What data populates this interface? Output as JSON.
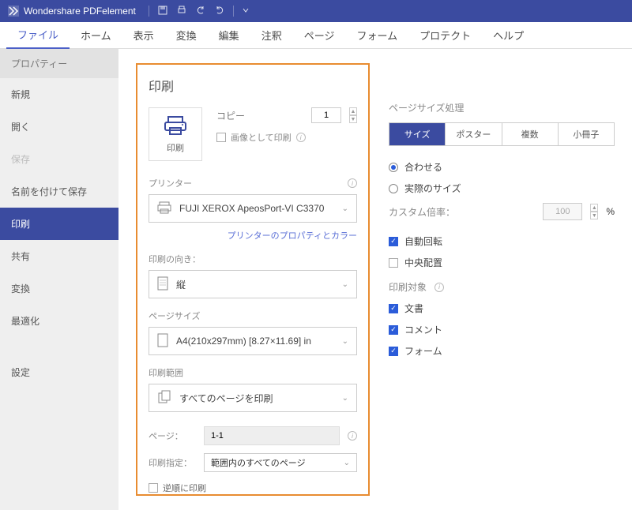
{
  "titlebar": {
    "title": "Wondershare PDFelement"
  },
  "menu": {
    "items": [
      "ファイル",
      "ホーム",
      "表示",
      "変換",
      "編集",
      "注釈",
      "ページ",
      "フォーム",
      "プロテクト",
      "ヘルプ"
    ],
    "active": 0
  },
  "sidebar": {
    "header": "プロパティー",
    "items": [
      {
        "label": "新規",
        "sel": false,
        "muted": false
      },
      {
        "label": "開く",
        "sel": false,
        "muted": false
      },
      {
        "label": "保存",
        "sel": false,
        "muted": true
      },
      {
        "label": "名前を付けて保存",
        "sel": false,
        "muted": false
      },
      {
        "label": "印刷",
        "sel": true,
        "muted": false
      },
      {
        "label": "共有",
        "sel": false,
        "muted": false
      },
      {
        "label": "変換",
        "sel": false,
        "muted": false
      },
      {
        "label": "最適化",
        "sel": false,
        "muted": false
      },
      {
        "label": "設定",
        "sel": false,
        "muted": false
      }
    ]
  },
  "print": {
    "heading": "印刷",
    "card_label": "印刷",
    "copy_label": "コピー",
    "copy_value": "1",
    "as_image_label": "画像として印刷",
    "printer_label": "プリンター",
    "printer_value": "FUJI XEROX ApeosPort-VI C3370",
    "printer_link": "プリンターのプロパティとカラー",
    "orient_label": "印刷の向き：",
    "orient_value": "縦",
    "size_label": "ページサイズ",
    "size_value": "A4(210x297mm) [8.27×11.69] in",
    "range_label": "印刷範囲",
    "range_value": "すべてのページを印刷",
    "pages_label": "ページ：",
    "pages_value": "1-1",
    "print_spec_label": "印刷指定：",
    "print_spec_value": "範囲内のすべてのページ",
    "reverse_label": "逆順に印刷"
  },
  "right": {
    "size_proc_label": "ページサイズ処理",
    "seg": [
      "サイズ",
      "ポスター",
      "複数",
      "小冊子"
    ],
    "seg_active": 0,
    "radios": [
      {
        "label": "合わせる",
        "on": true
      },
      {
        "label": "実際のサイズ",
        "on": false
      }
    ],
    "scale_label": "カスタム倍率：",
    "scale_value": "100",
    "scale_unit": "%",
    "auto_rotate": {
      "label": "自動回転",
      "on": true
    },
    "center": {
      "label": "中央配置",
      "on": false
    },
    "target_label": "印刷対象",
    "targets": [
      {
        "label": "文書",
        "on": true
      },
      {
        "label": "コメント",
        "on": true
      },
      {
        "label": "フォーム",
        "on": true
      }
    ]
  }
}
